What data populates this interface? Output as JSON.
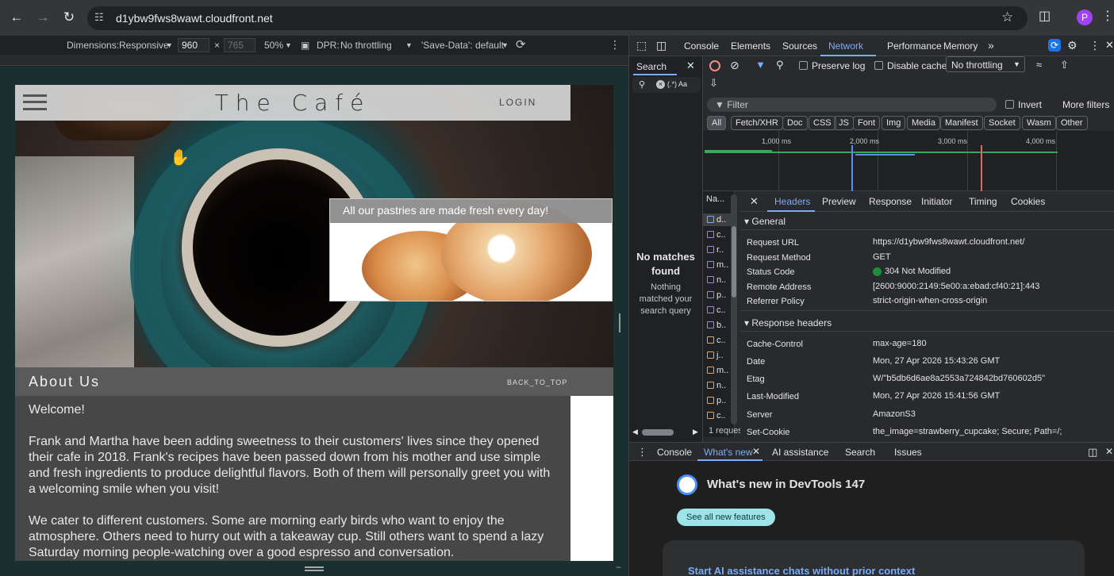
{
  "browser": {
    "url": "d1ybw9fws8wawt.cloudfront.net",
    "avatar": "P"
  },
  "device_toolbar": {
    "dimensions_label": "Dimensions:",
    "dimensions_value": "Responsive",
    "width": "960",
    "times": "×",
    "height": "765",
    "zoom": "50%",
    "dpr_label": "DPR:",
    "throttle": "No throttling",
    "save_data": "'Save-Data': default"
  },
  "site": {
    "brand": "The Café",
    "login": "LOGIN",
    "promo_caption": "All our pastries are made fresh every day!",
    "about_title": "About Us",
    "back_to_top": "BACK_TO_TOP",
    "welcome": "Welcome!",
    "p1": "Frank and Martha have been adding sweetness to their customers' lives since they opened their cafe in 2018. Frank's recipes have been passed down from his mother and use simple and fresh ingredients to produce delightful flavors. Both of them will personally greet you with a welcoming smile when you visit!",
    "p2": "We cater to different customers. Some are morning early birds who want to enjoy the atmosphere. Others need to hurry out with a takeaway cup. Still others want to spend a lazy Saturday morning people-watching over a good espresso and conversation."
  },
  "devtools": {
    "tabs": [
      "Console",
      "Elements",
      "Sources",
      "Network",
      "Performance",
      "Memory"
    ],
    "search_tab": "Search",
    "search_opts": "(.*) Aa",
    "preserve_log": "Preserve log",
    "disable_cache": "Disable cache",
    "throttling": "No throttling",
    "filter_placeholder": "Filter",
    "invert": "Invert",
    "more_filters": "More filters",
    "chips": [
      "All",
      "Fetch/XHR",
      "Doc",
      "CSS",
      "JS",
      "Font",
      "Img",
      "Media",
      "Manifest",
      "Socket",
      "Wasm",
      "Other"
    ],
    "ticks": [
      "1,000 ms",
      "2,000 ms",
      "3,000 ms",
      "4,000 ms"
    ],
    "no_matches": "No matches found",
    "no_matches_sub": "Nothing matched your search query",
    "name_col": "Na...",
    "requests": [
      "d..",
      "c..",
      "r..",
      "m..",
      "n..",
      "p..",
      "c..",
      "b..",
      "c..",
      "j..",
      "m..",
      "n..",
      "p..",
      "c.."
    ],
    "req_footer": "1 reques",
    "detail_tabs": [
      "Headers",
      "Preview",
      "Response",
      "Initiator",
      "Timing",
      "Cookies"
    ],
    "general_title": "General",
    "general": [
      {
        "k": "Request URL",
        "v": "https://d1ybw9fws8wawt.cloudfront.net/"
      },
      {
        "k": "Request Method",
        "v": "GET"
      },
      {
        "k": "Status Code",
        "v": "304 Not Modified"
      },
      {
        "k": "Remote Address",
        "v": "[2600:9000:2149:5e00:a:ebad:cf40:21]:443"
      },
      {
        "k": "Referrer Policy",
        "v": "strict-origin-when-cross-origin"
      }
    ],
    "response_title": "Response headers",
    "response": [
      {
        "k": "Cache-Control",
        "v": "max-age=180"
      },
      {
        "k": "Date",
        "v": "Mon, 27 Apr 2026 15:43:26 GMT"
      },
      {
        "k": "Etag",
        "v": "W/\"b5db6d6ae8a2553a724842bd760602d5\""
      },
      {
        "k": "Last-Modified",
        "v": "Mon, 27 Apr 2026 15:41:56 GMT"
      },
      {
        "k": "Server",
        "v": "AmazonS3"
      },
      {
        "k": "Set-Cookie",
        "v": "the_image=strawberry_cupcake; Secure; Path=/;"
      }
    ],
    "status_color": "#1e8e3e",
    "drawer_tabs": [
      "Console",
      "What's new",
      "AI assistance",
      "Search",
      "Issues"
    ],
    "whats_new_title": "What's new in DevTools 147",
    "see_all": "See all new features",
    "ai_card": "Start AI assistance chats without prior context"
  }
}
